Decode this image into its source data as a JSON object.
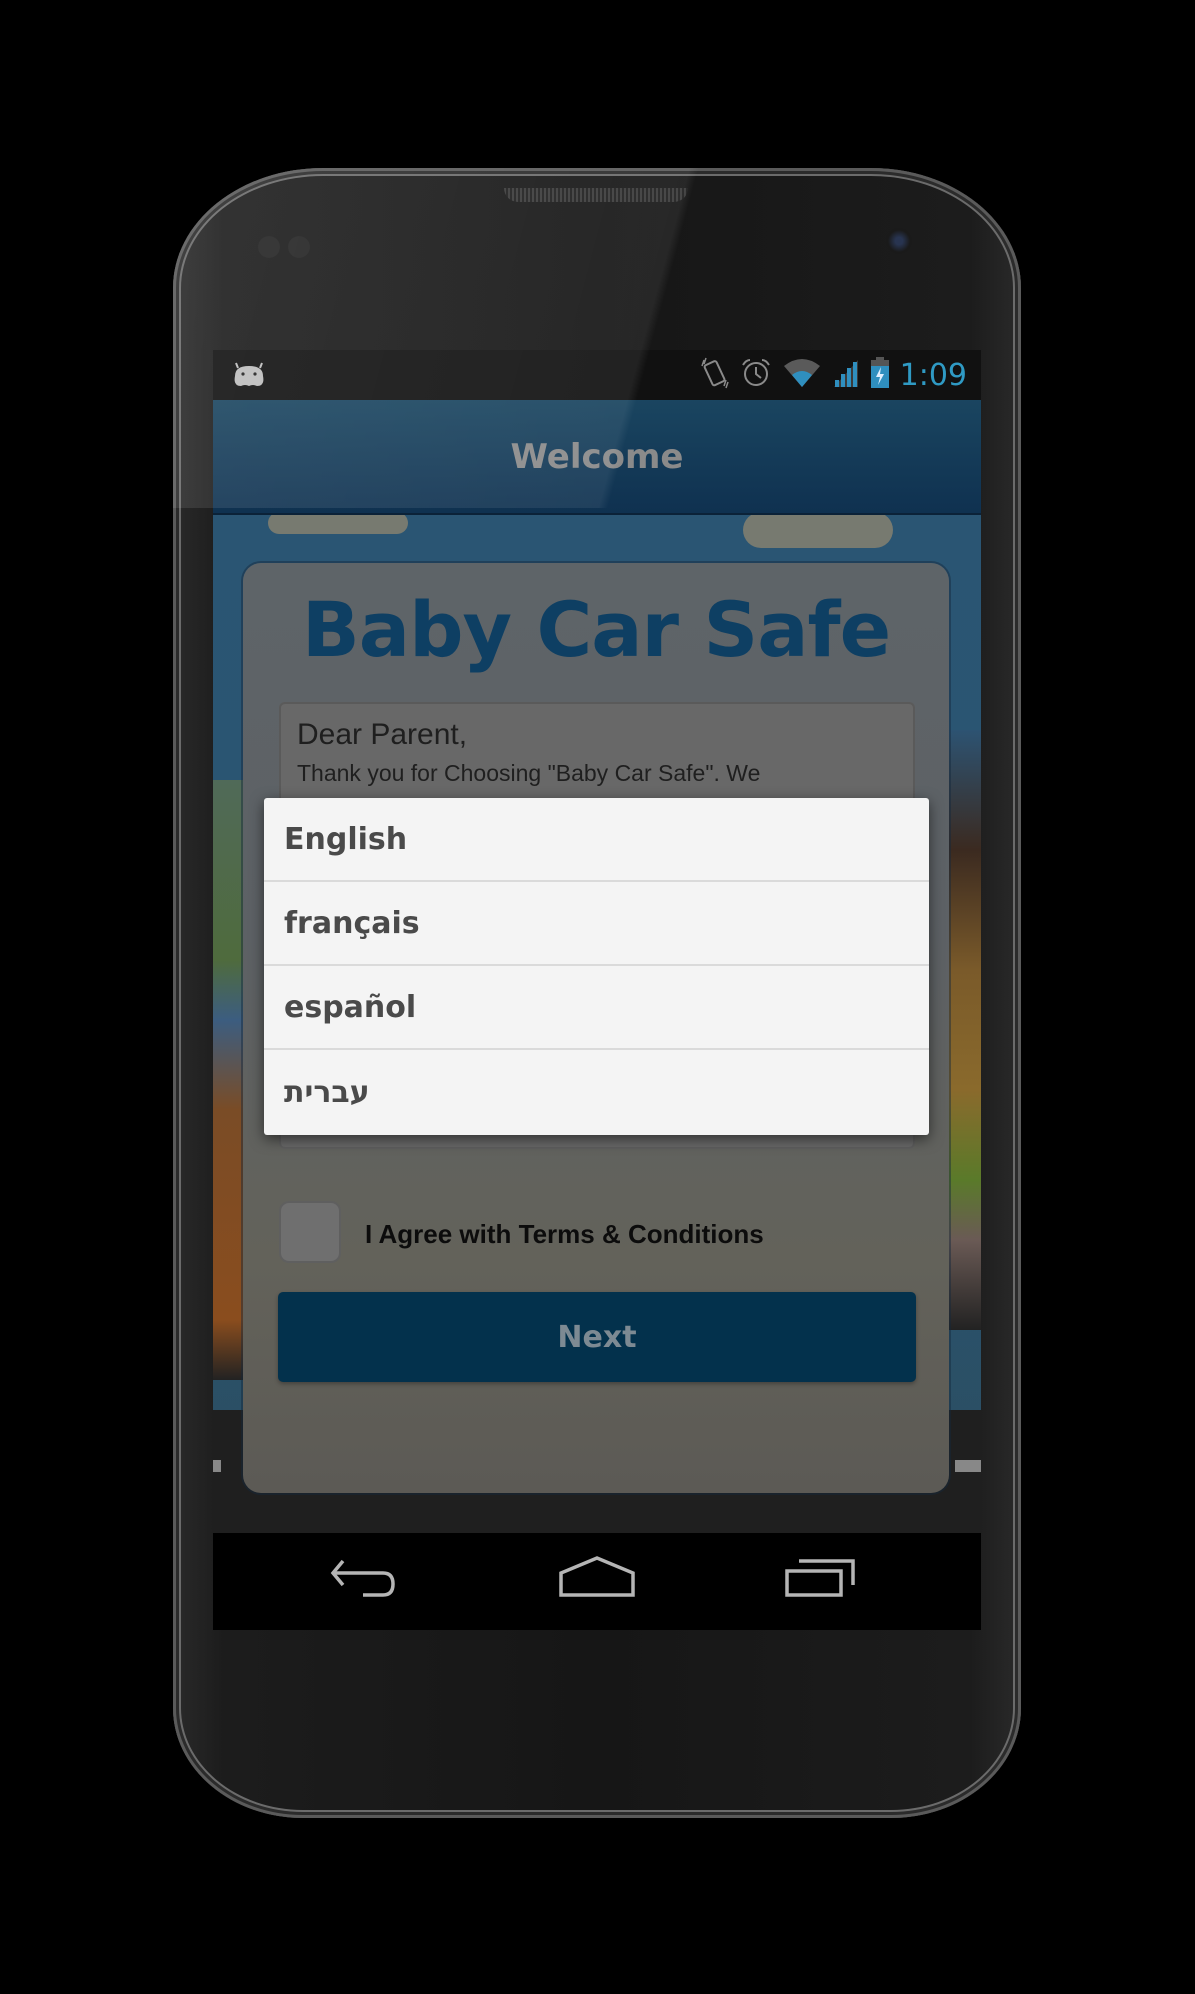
{
  "status_bar": {
    "notification_icon": "android-debug-icon",
    "icons": [
      "vibrate-icon",
      "alarm-icon",
      "wifi-icon",
      "signal-icon",
      "battery-charging-icon"
    ],
    "time": "1:09",
    "time_color": "#33b5e5"
  },
  "action_bar": {
    "title": "Welcome"
  },
  "card": {
    "app_title": "Baby Car Safe",
    "message": {
      "greeting": "Dear Parent,",
      "body": "Thank you for Choosing \"Baby Car Safe\". We"
    },
    "language_spinner": {
      "selected": "English"
    },
    "terms_checkbox": {
      "label": "I Agree with Terms & Conditions",
      "checked": false
    },
    "next_button": "Next"
  },
  "language_popup": {
    "options": [
      {
        "label": "English"
      },
      {
        "label": "français"
      },
      {
        "label": "español"
      },
      {
        "label": "עברית"
      }
    ]
  },
  "nav_bar": {
    "buttons": [
      "back-icon",
      "home-icon",
      "recents-icon"
    ]
  },
  "colors": {
    "brand_dark_blue": "#0e3f63",
    "button_blue": "#03314c",
    "popup_background": "#f4f4f4"
  }
}
